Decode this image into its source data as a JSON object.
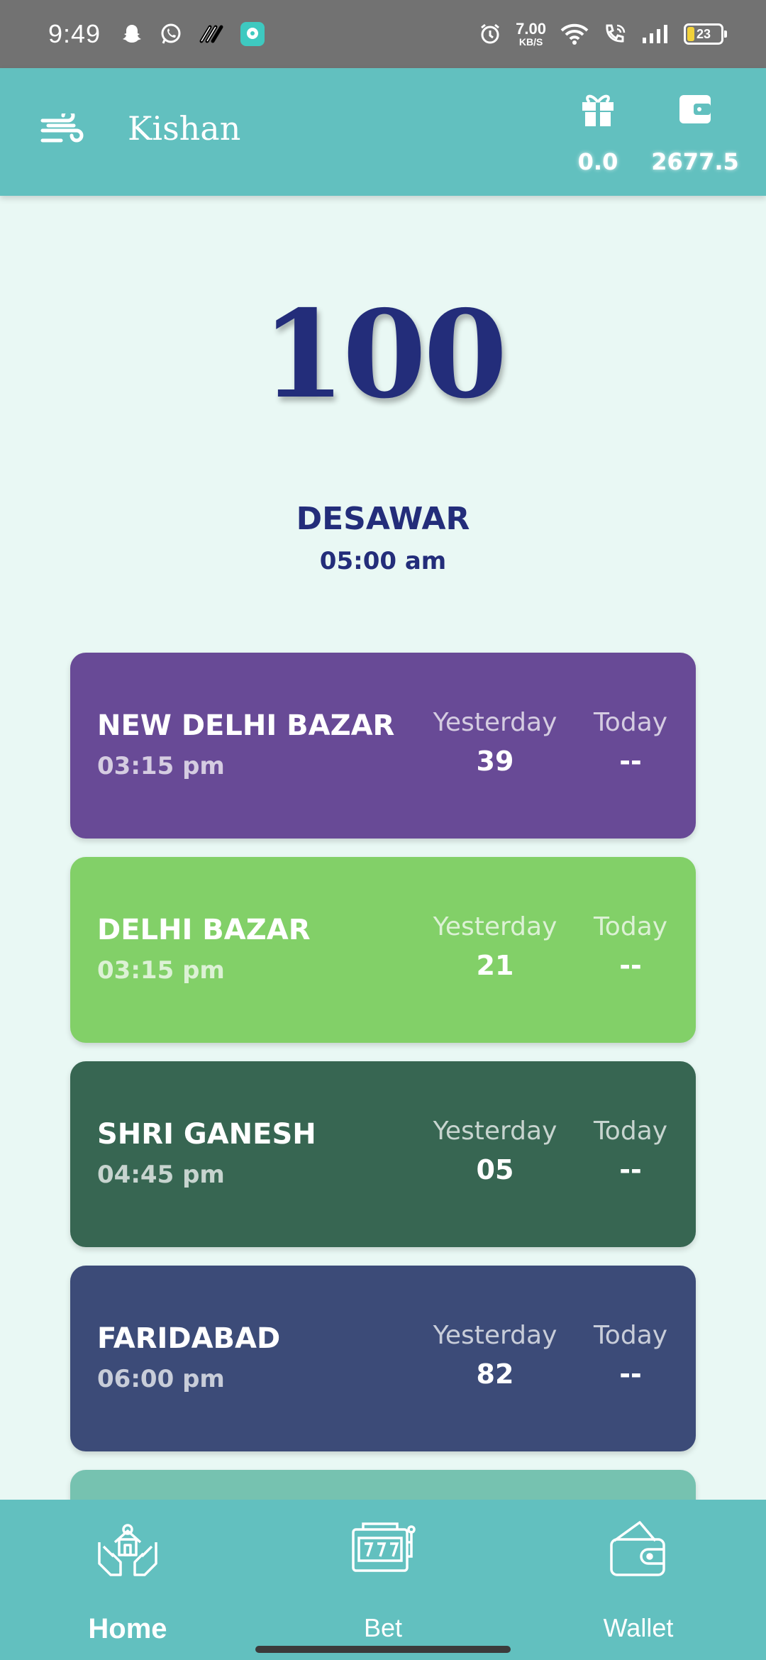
{
  "status_bar": {
    "time": "9:49",
    "net_speed_value": "7.00",
    "net_speed_unit": "KB/S",
    "battery": "23",
    "left_icons": [
      "snapchat-icon",
      "whatsapp-icon",
      "app-icon",
      "chat-icon"
    ],
    "right_icons": [
      "alarm-icon",
      "wifi-icon",
      "call-wifi-icon",
      "signal-icon",
      "battery-icon"
    ]
  },
  "header": {
    "title": "Kishan",
    "bonus_value": "0.0",
    "wallet_value": "2677.5",
    "colors": {
      "header_bg": "#62c0bf"
    }
  },
  "featured": {
    "result": "100",
    "name": "DESAWAR",
    "time": "05:00 am"
  },
  "cards": {
    "items": [
      {
        "name": "NEW DELHI BAZAR",
        "time": "03:15 pm",
        "yesterday_label": "Yesterday",
        "yesterday_value": "39",
        "today_label": "Today",
        "today_value": "--",
        "color": "#684a96"
      },
      {
        "name": "DELHI BAZAR",
        "time": "03:15 pm",
        "yesterday_label": "Yesterday",
        "yesterday_value": "21",
        "today_label": "Today",
        "today_value": "--",
        "color": "#82d068"
      },
      {
        "name": "SHRI GANESH",
        "time": "04:45 pm",
        "yesterday_label": "Yesterday",
        "yesterday_value": "05",
        "today_label": "Today",
        "today_value": "--",
        "color": "#376652"
      },
      {
        "name": "FARIDABAD",
        "time": "06:00 pm",
        "yesterday_label": "Yesterday",
        "yesterday_value": "82",
        "today_label": "Today",
        "today_value": "--",
        "color": "#3c4b78"
      }
    ],
    "partial_card_color": "#76c2b0"
  },
  "bottom_nav": {
    "home": "Home",
    "bet": "Bet",
    "wallet": "Wallet"
  }
}
